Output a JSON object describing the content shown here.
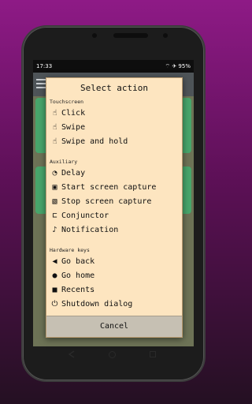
{
  "status": {
    "time": "17:33",
    "right": "⌔ ✈ 95%"
  },
  "dialog": {
    "title": "Select action",
    "sections": [
      {
        "label": "Touchscreen",
        "items": [
          {
            "icon": "☝",
            "label": "Click"
          },
          {
            "icon": "☝",
            "label": "Swipe"
          },
          {
            "icon": "☝",
            "label": "Swipe and hold"
          }
        ]
      },
      {
        "label": "Auxiliary",
        "items": [
          {
            "icon": "◔",
            "label": "Delay"
          },
          {
            "icon": "▣",
            "label": "Start screen capture"
          },
          {
            "icon": "▧",
            "label": "Stop screen capture"
          },
          {
            "icon": "⊏",
            "label": "Conjunctor"
          },
          {
            "icon": "♪",
            "label": "Notification"
          }
        ]
      },
      {
        "label": "Hardware keys",
        "items": [
          {
            "icon": "◀",
            "label": "Go back"
          },
          {
            "icon": "●",
            "label": "Go home"
          },
          {
            "icon": "■",
            "label": "Recents"
          },
          {
            "icon": "⏻",
            "label": "Shutdown dialog"
          }
        ]
      }
    ],
    "cancel_label": "Cancel"
  }
}
